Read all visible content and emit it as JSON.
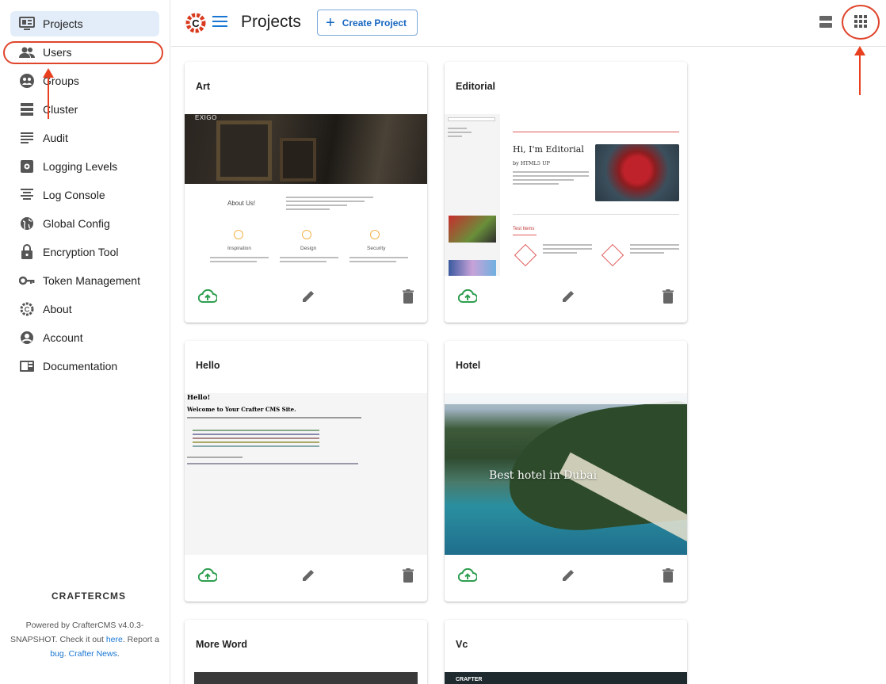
{
  "sidebar": {
    "items": [
      {
        "label": "Projects",
        "icon": "projects-icon"
      },
      {
        "label": "Users",
        "icon": "users-icon"
      },
      {
        "label": "Groups",
        "icon": "groups-icon"
      },
      {
        "label": "Cluster",
        "icon": "cluster-icon"
      },
      {
        "label": "Audit",
        "icon": "audit-icon"
      },
      {
        "label": "Logging Levels",
        "icon": "logging-levels-icon"
      },
      {
        "label": "Log Console",
        "icon": "log-console-icon"
      },
      {
        "label": "Global Config",
        "icon": "global-config-icon"
      },
      {
        "label": "Encryption Tool",
        "icon": "encryption-tool-icon"
      },
      {
        "label": "Token Management",
        "icon": "token-management-icon"
      },
      {
        "label": "About",
        "icon": "about-icon"
      },
      {
        "label": "Account",
        "icon": "account-icon"
      },
      {
        "label": "Documentation",
        "icon": "documentation-icon"
      }
    ],
    "brand": "CRAFTERCMS",
    "footer": {
      "powered_prefix": "Powered by CrafterCMS v4.0.3-SNAPSHOT. Check it out ",
      "here": "here",
      "report": ". Report a ",
      "bug": "bug",
      "sep": ". ",
      "news": "Crafter News",
      "end": "."
    }
  },
  "header": {
    "title": "Projects",
    "create_label": "Create Project"
  },
  "projects": [
    {
      "name": "Art"
    },
    {
      "name": "Editorial"
    },
    {
      "name": "Hello"
    },
    {
      "name": "Hotel"
    },
    {
      "name": "More Word"
    },
    {
      "name": "Vc"
    }
  ],
  "thumbs": {
    "art": {
      "brand": "EXIGO",
      "about": "About Us!",
      "features": [
        "Inspiration",
        "Design",
        "Security"
      ]
    },
    "editorial": {
      "title": "Hi, I'm Editorial",
      "subtitle": "by HTML5 UP",
      "section": "Test Items"
    },
    "hello": {
      "h1": "Hello!",
      "h2": "Welcome to Your Crafter CMS Site."
    },
    "hotel": {
      "caption": "Best hotel in Dubai"
    },
    "vc": {
      "brand": "CRAFTER"
    }
  },
  "colors": {
    "accent": "#1976d2",
    "annotation": "#e0452c",
    "publish": "#2e9e4f",
    "active_nav": "#e3edf9"
  }
}
